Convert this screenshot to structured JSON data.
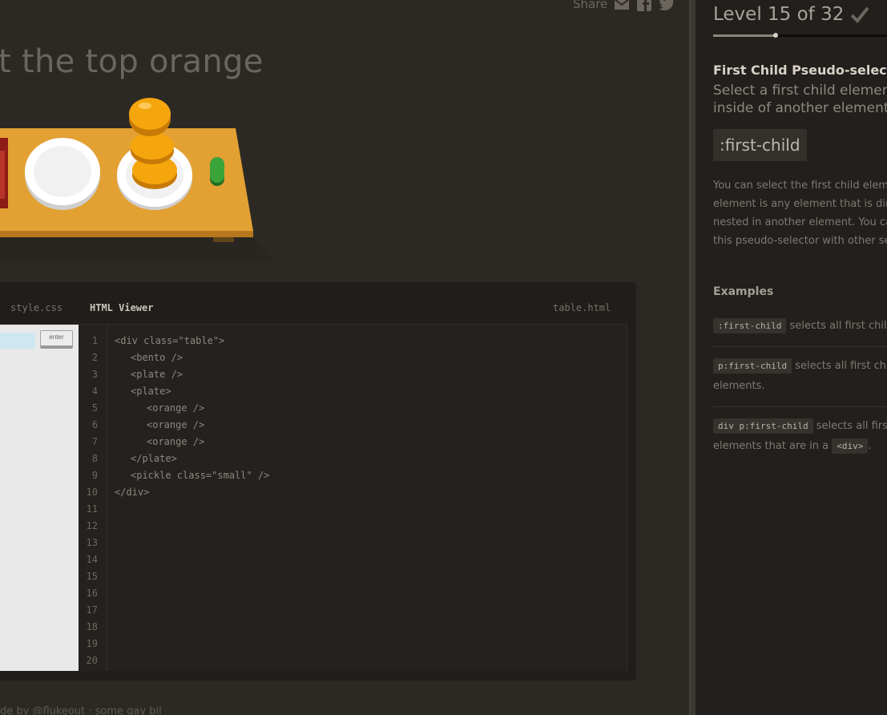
{
  "share": {
    "label": "Share",
    "icons": [
      "envelope-icon",
      "facebook-icon",
      "twitter-icon"
    ]
  },
  "page": {
    "title": "t the top orange"
  },
  "editor": {
    "tabs": {
      "css": "style.css",
      "html": "HTML Viewer",
      "file": "table.html"
    },
    "enter_label": "enter",
    "line_numbers": [
      "1",
      "2",
      "3",
      "4",
      "5",
      "6",
      "7",
      "8",
      "9",
      "10",
      "11",
      "12",
      "13",
      "14",
      "15",
      "16",
      "17",
      "18",
      "19",
      "20"
    ],
    "code_lines": [
      "<div class=\"table\">",
      "<bento />",
      "<plate />",
      "<plate>",
      "<orange />",
      "<orange />",
      "<orange />",
      "</plate>",
      "<pickle class=\"small\" />",
      "</div>"
    ]
  },
  "footer": {
    "text": "de by @flukeout · some gay bil"
  },
  "sidebar": {
    "level": "Level 15 of 32",
    "level_current": 15,
    "level_total": 32,
    "check_icon": "checkmark-icon",
    "selector_name": "First Child Pseudo-selector",
    "selector_title": "Select a first child element inside of another element",
    "syntax": ":first-child",
    "hint": "You can select the first child element. A child element is any element that is directly nested in another element. You can combine this pseudo-selector with other selectors.",
    "examples_title": "Examples",
    "examples": [
      {
        "code": ":first-child",
        "text": "selects all first child elements."
      },
      {
        "code": "p:first-child",
        "text": "selects all first child",
        "text2": "elements."
      },
      {
        "code": "div p:first-child",
        "text": "selects all first child",
        "text2a": "elements that are in a",
        "code2": "<div>",
        "text2b": "."
      }
    ]
  },
  "colors": {
    "background": "#2c2925",
    "sidebar": "#221f1c",
    "table": "#e09a2e",
    "orange": "#f4a60c",
    "pickle": "#3aa33a"
  }
}
